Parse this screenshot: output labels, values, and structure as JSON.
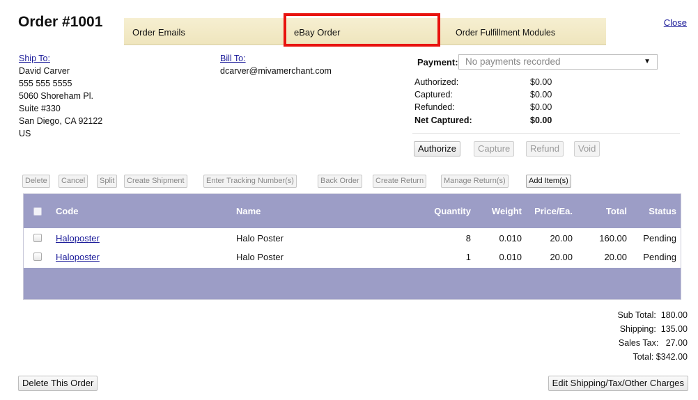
{
  "order": {
    "title": "Order #1001"
  },
  "tabs": [
    {
      "label": "Order Emails"
    },
    {
      "label": "eBay Order"
    },
    {
      "label": "Order Fulfillment Modules"
    }
  ],
  "close_label": "Close",
  "ship_to": {
    "label": "Ship To:",
    "lines": [
      "David Carver",
      "555 555 5555",
      "5060 Shoreham Pl.",
      "Suite #330",
      "San Diego, CA 92122",
      "US"
    ]
  },
  "bill_to": {
    "label": "Bill To:",
    "email": "dcarver@mivamerchant.com"
  },
  "payment": {
    "label": "Payment:",
    "selected": "No payments recorded",
    "rows": [
      {
        "label": "Authorized:",
        "value": "$0.00"
      },
      {
        "label": "Captured:",
        "value": "$0.00"
      },
      {
        "label": "Refunded:",
        "value": "$0.00"
      },
      {
        "label": "Net Captured:",
        "value": "$0.00"
      }
    ],
    "buttons": [
      "Authorize",
      "Capture",
      "Refund",
      "Void"
    ]
  },
  "toolbar": {
    "buttons": [
      "Delete",
      "Cancel",
      "Split",
      "Create Shipment",
      "Enter Tracking Number(s)",
      "Back Order",
      "Create Return",
      "Manage Return(s)",
      "Add Item(s)"
    ]
  },
  "table": {
    "headers": [
      "Code",
      "Name",
      "Quantity",
      "Weight",
      "Price/Ea.",
      "Total",
      "Status"
    ],
    "rows": [
      {
        "code": "Haloposter",
        "name": "Halo Poster",
        "quantity": "8",
        "weight": "0.010",
        "price": "20.00",
        "total": "160.00",
        "status": "Pending"
      },
      {
        "code": "Haloposter",
        "name": "Halo Poster",
        "quantity": "1",
        "weight": "0.010",
        "price": "20.00",
        "total": "20.00",
        "status": "Pending"
      }
    ]
  },
  "totals": {
    "subtotal": "Sub Total:  180.00",
    "shipping": "Shipping:  135.00",
    "tax": "Sales Tax:   27.00",
    "total": "Total: $342.00"
  },
  "footer": {
    "delete_label": "Delete This Order",
    "edit_label": "Edit Shipping/Tax/Other Charges"
  },
  "colors": {
    "tab_bar": "#f2eac6",
    "table_header": "#9c9dc6",
    "highlight": "#e8130f",
    "link": "#1a1a99"
  }
}
